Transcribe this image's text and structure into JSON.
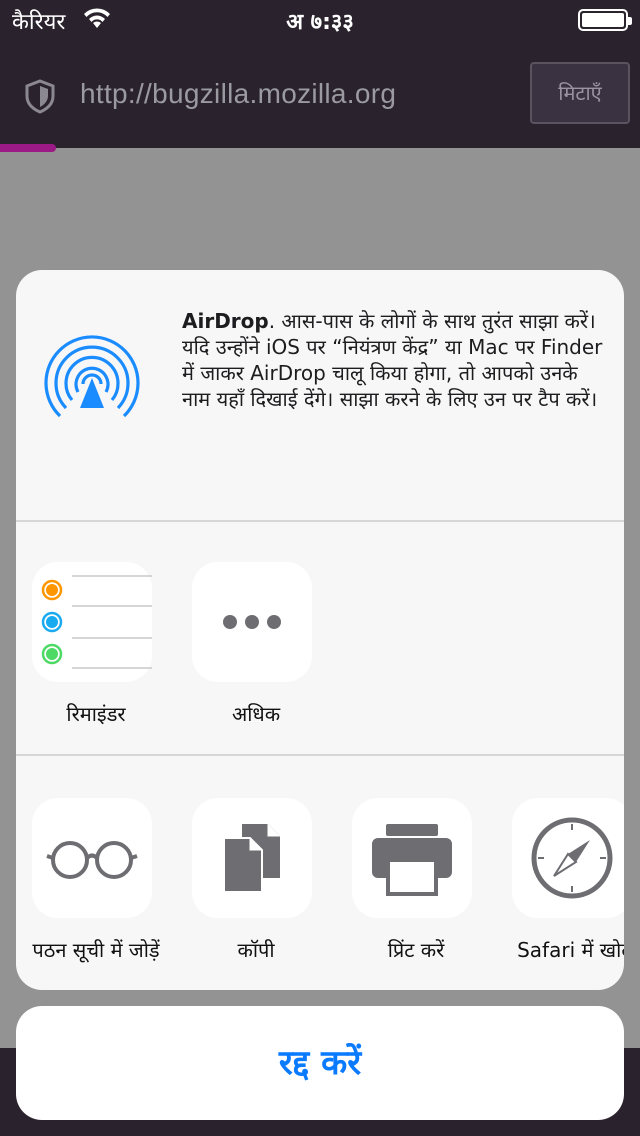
{
  "status_bar": {
    "carrier": "कैरियर",
    "time": "अ ७:३३"
  },
  "url_bar": {
    "url": "http://bugzilla.mozilla.org",
    "clear_label": "मिटाएँ"
  },
  "airdrop": {
    "title": "AirDrop",
    "description": ". आस-पास के लोगों के साथ तुरंत साझा करें। यदि उन्होंने iOS पर “नियंत्रण केंद्र” या Mac पर Finder में जाकर AirDrop चालू किया होगा, तो आपको उनके नाम यहाँ दिखाई देंगे। साझा करने के लिए उन पर टैप करें।"
  },
  "apps": [
    {
      "label": "रिमाइंडर",
      "icon": "reminders-icon"
    },
    {
      "label": "अधिक",
      "icon": "more-icon"
    }
  ],
  "actions": [
    {
      "label": "पठन सूची में जोड़ें",
      "icon": "glasses-icon"
    },
    {
      "label": "कॉपी",
      "icon": "copy-icon"
    },
    {
      "label": "प्रिंट करें",
      "icon": "printer-icon"
    },
    {
      "label": "Safari में खोलें",
      "icon": "compass-icon"
    }
  ],
  "cancel_label": "रद्द करें",
  "colors": {
    "accent": "#0a7aff",
    "progress": "#9b1a85",
    "top_bar": "#2a222d"
  }
}
